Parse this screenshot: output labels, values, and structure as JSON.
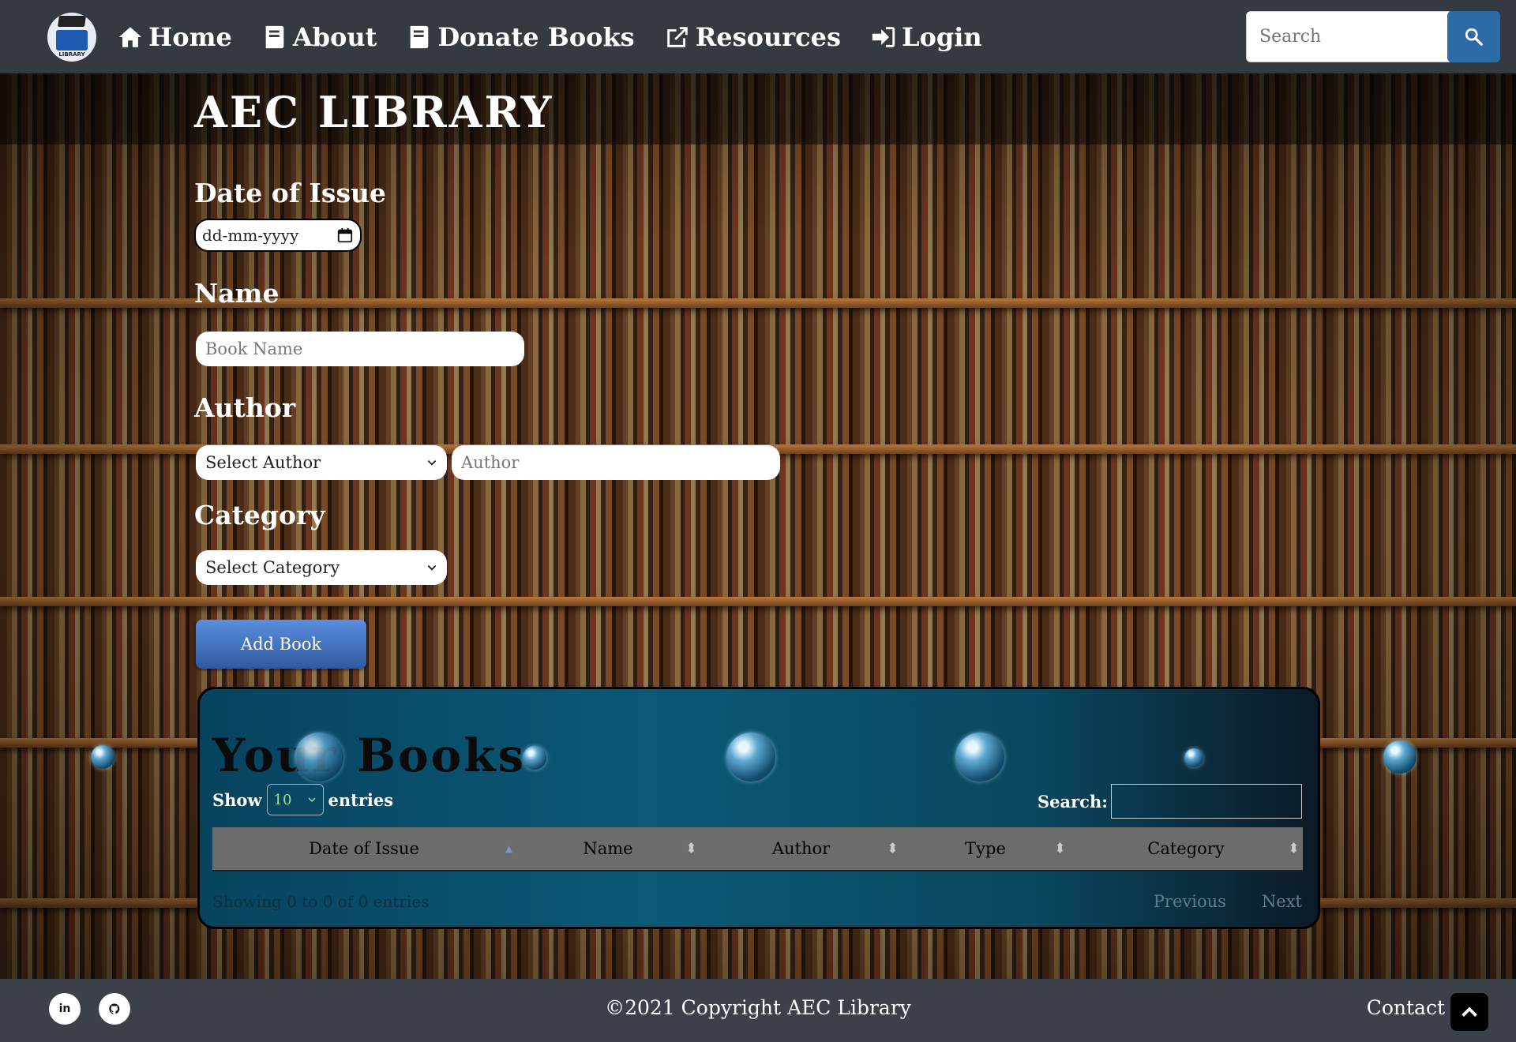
{
  "nav": {
    "logo_text": "LIBRARY",
    "items": [
      {
        "label": "Home",
        "icon": "home-icon"
      },
      {
        "label": "About",
        "icon": "book-icon"
      },
      {
        "label": "Donate Books",
        "icon": "book-icon"
      },
      {
        "label": "Resources",
        "icon": "external-link-icon"
      },
      {
        "label": "Login",
        "icon": "sign-in-icon"
      }
    ],
    "search_placeholder": "Search"
  },
  "form": {
    "title": "AEC LIBRARY",
    "date_label": "Date of Issue",
    "date_placeholder": "dd-mm-yyyy",
    "name_label": "Name",
    "name_placeholder": "Book Name",
    "author_label": "Author",
    "author_select": "Select Author",
    "author_placeholder": "Author",
    "category_label": "Category",
    "category_select": "Select Category",
    "add_button": "Add Book"
  },
  "books": {
    "title": "Your Books",
    "show_label": "Show",
    "entries_value": "10",
    "entries_label": "entries",
    "search_label": "Search:",
    "columns": [
      "Date of Issue",
      "Name",
      "Author",
      "Type",
      "Category"
    ],
    "info": "Showing 0 to 0 of 0 entries",
    "previous": "Previous",
    "next": "Next"
  },
  "footer": {
    "linkedin": "in",
    "copyright": "©2021 Copyright AEC Library",
    "contact": "Contact"
  },
  "colors": {
    "navbar": "#343a40",
    "search_button": "#2d6ba8",
    "add_button": "#4a7bc8",
    "panel": "#0b5976"
  }
}
